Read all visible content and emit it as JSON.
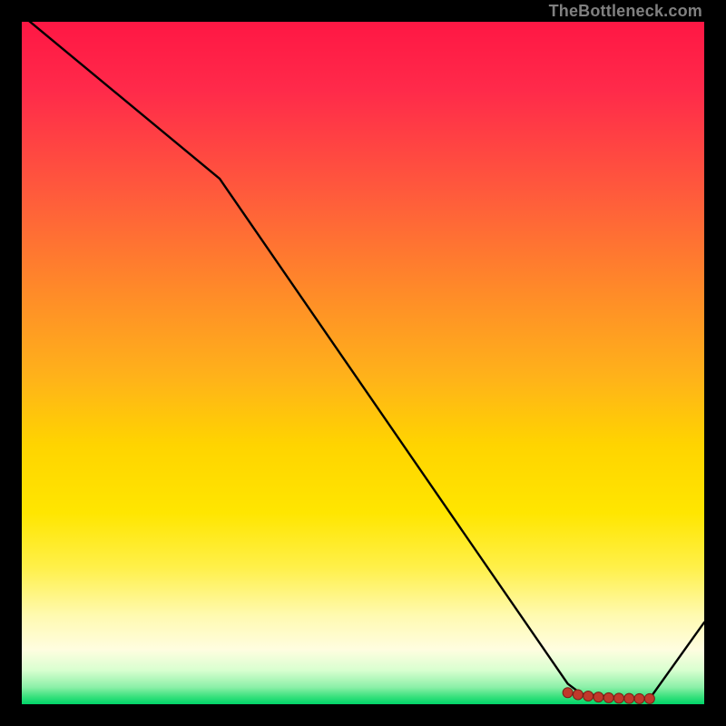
{
  "watermark": "TheBottleneck.com",
  "chart_data": {
    "type": "line",
    "title": "",
    "xlabel": "",
    "ylabel": "",
    "xlim": [
      0,
      100
    ],
    "ylim": [
      0,
      100
    ],
    "series": [
      {
        "name": "bottleneck-curve",
        "x": [
          0,
          29,
          80,
          82,
          90,
          92,
          100
        ],
        "values": [
          101,
          77,
          3,
          1.5,
          0.8,
          0.8,
          12
        ]
      }
    ],
    "markers": {
      "name": "bottleneck-band",
      "x": [
        80.0,
        81.5,
        83.0,
        84.5,
        86.0,
        87.5,
        89.0,
        90.5,
        92.0
      ],
      "values": [
        1.7,
        1.4,
        1.2,
        1.05,
        0.95,
        0.88,
        0.84,
        0.82,
        0.82
      ]
    },
    "gradient_stops": [
      {
        "pos": 0,
        "color": "#ff1744"
      },
      {
        "pos": 0.62,
        "color": "#ffd400"
      },
      {
        "pos": 0.92,
        "color": "#fffde0"
      },
      {
        "pos": 1.0,
        "color": "#00d469"
      }
    ]
  }
}
